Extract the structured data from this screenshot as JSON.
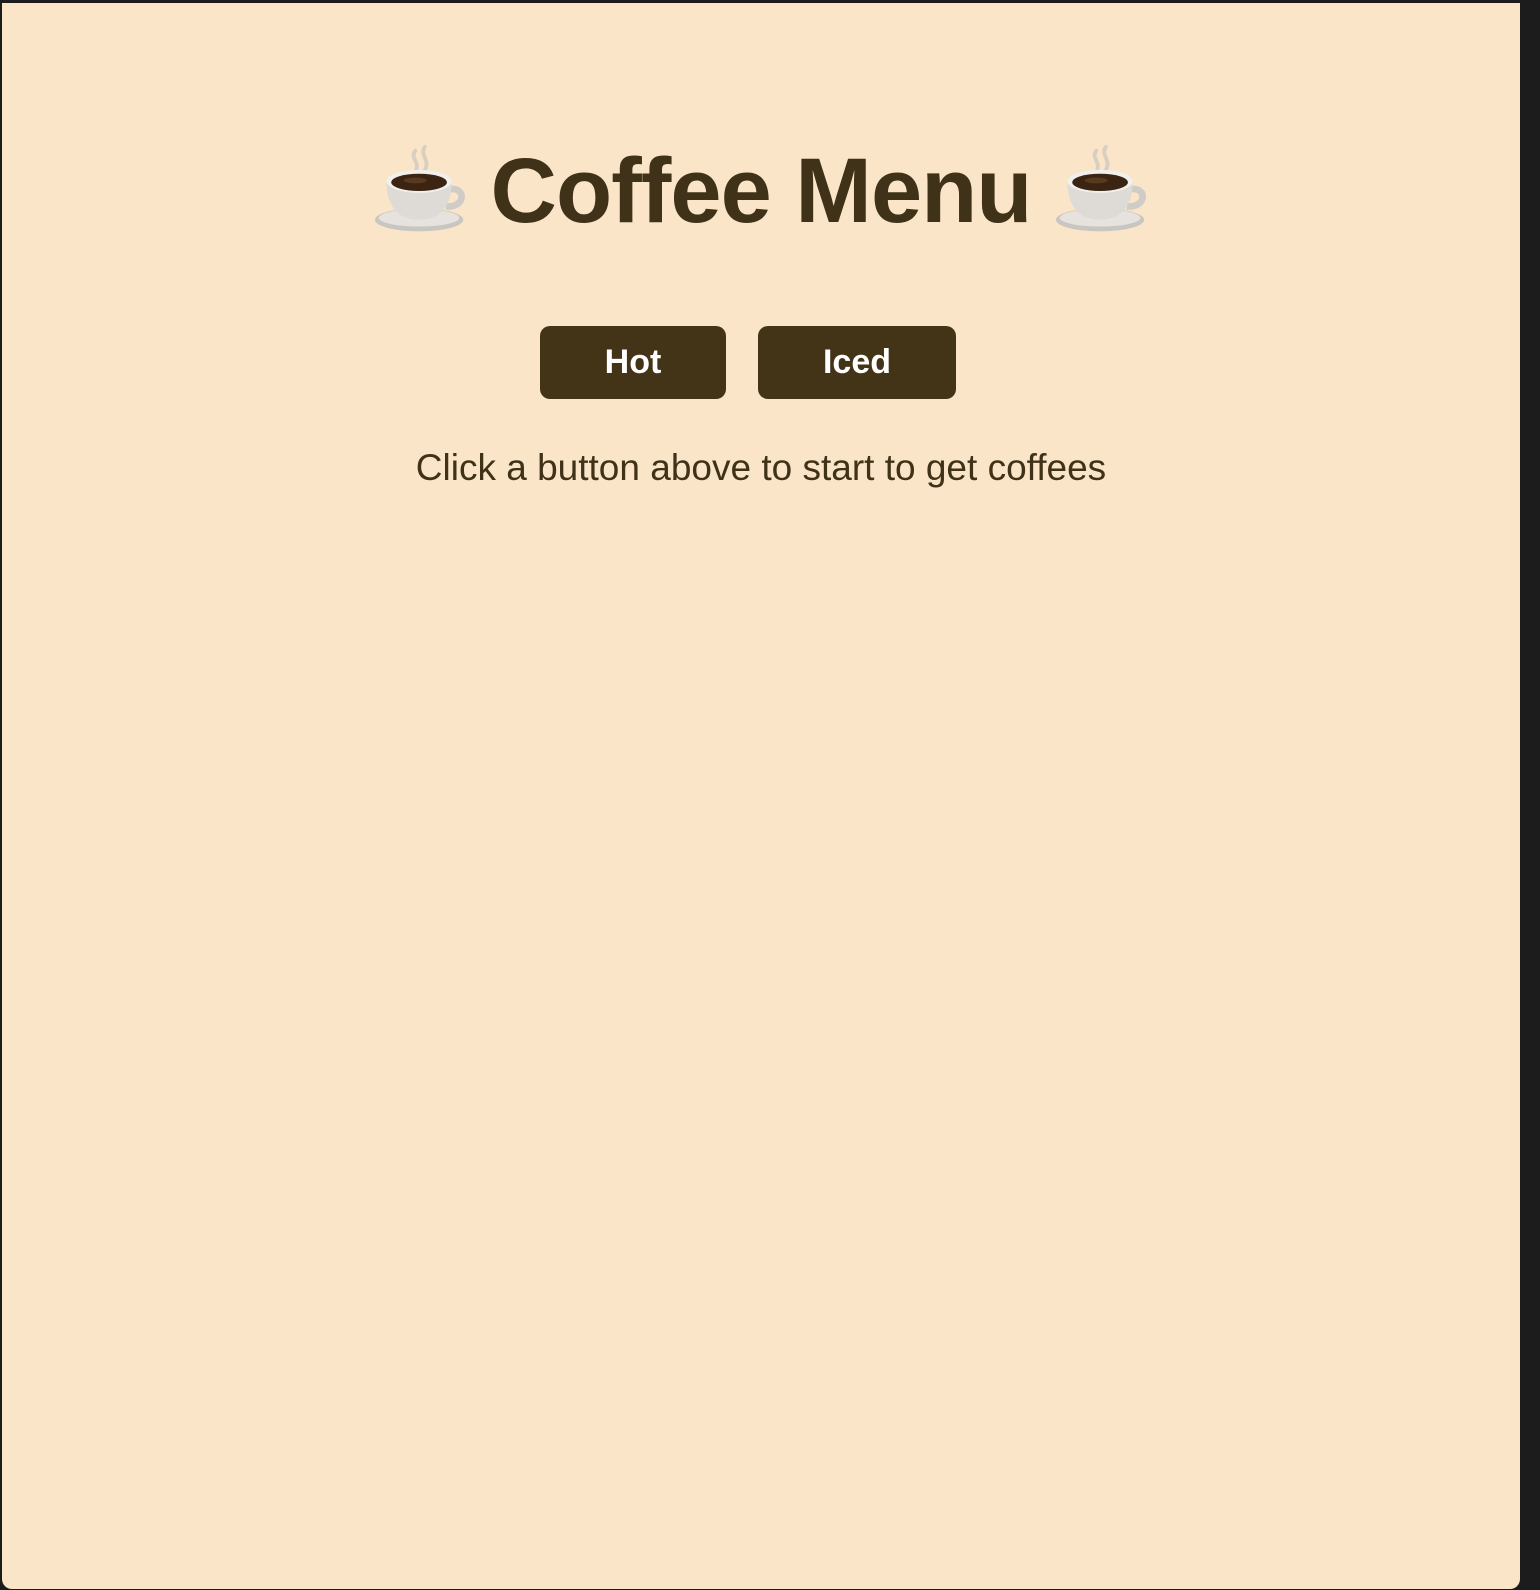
{
  "page": {
    "title": "Coffee Menu",
    "background_color": "#fae5c8",
    "text_color": "#3f3218",
    "button_color": "#433418",
    "left_icon": "coffee-cup-icon",
    "right_icon": "coffee-cup-icon"
  },
  "buttons": {
    "hot_label": "Hot",
    "iced_label": "Iced"
  },
  "hint": {
    "text": "Click a button above to start to get coffees"
  }
}
